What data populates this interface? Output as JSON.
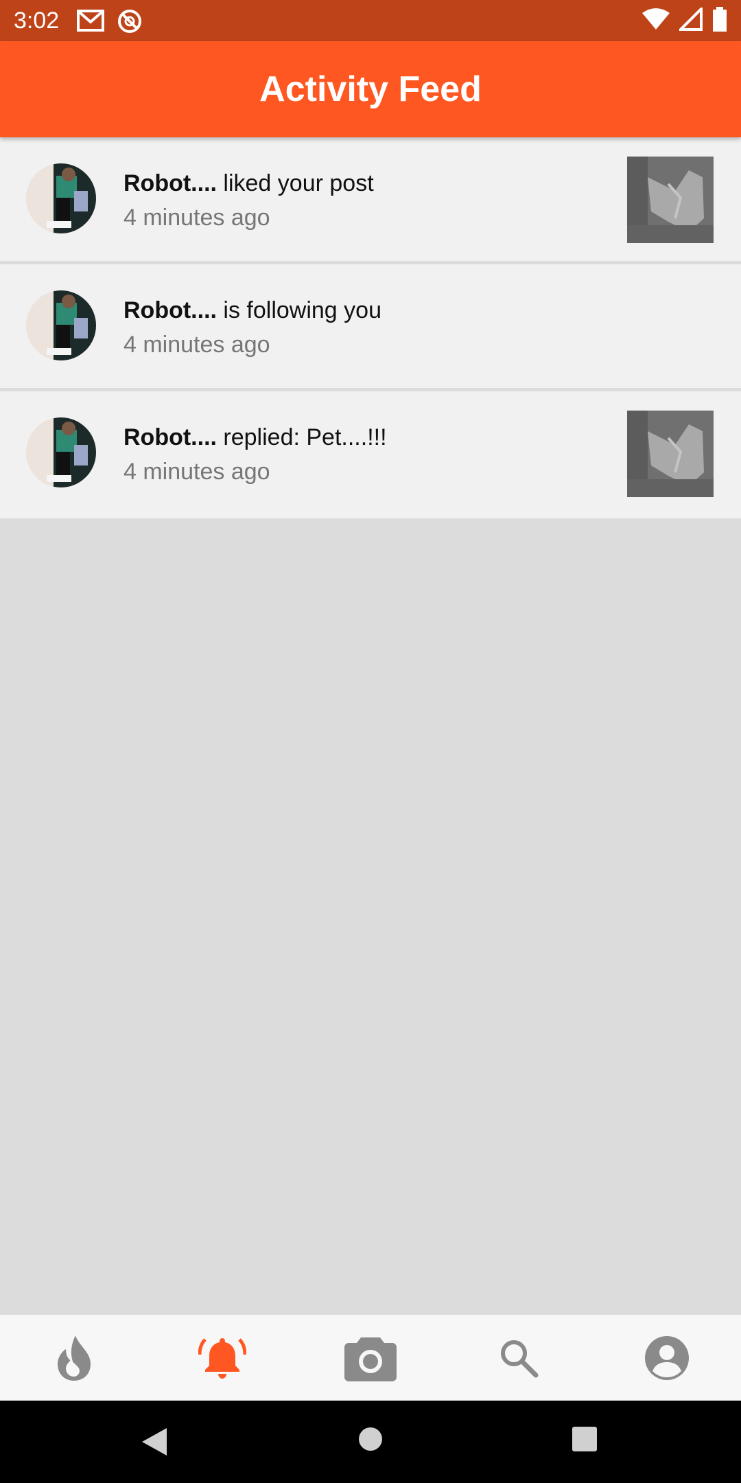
{
  "status_bar": {
    "time": "3:02",
    "left_icons": [
      "gmail-icon",
      "sync-blocked-icon"
    ],
    "right_icons": [
      "wifi-icon",
      "signal-icon",
      "battery-icon"
    ],
    "color": "#bf4319"
  },
  "app_bar": {
    "title": "Activity Feed",
    "color": "#ff5722"
  },
  "feed": [
    {
      "username": "Robot....",
      "action": " liked your post",
      "time": "4 minutes ago",
      "has_thumbnail": true
    },
    {
      "username": "Robot....",
      "action": " is following you",
      "time": "4 minutes ago",
      "has_thumbnail": false
    },
    {
      "username": "Robot....",
      "action": " replied: Pet....!!!",
      "time": "4 minutes ago",
      "has_thumbnail": true
    }
  ],
  "bottom_nav": {
    "items": [
      {
        "icon": "fire-icon",
        "active": false
      },
      {
        "icon": "bell-icon",
        "active": true
      },
      {
        "icon": "camera-icon",
        "active": false
      },
      {
        "icon": "search-icon",
        "active": false
      },
      {
        "icon": "account-icon",
        "active": false
      }
    ],
    "active_color": "#ff5722",
    "inactive_color": "#8a8a8a"
  },
  "system_nav": [
    "back-icon",
    "home-icon",
    "recents-icon"
  ]
}
